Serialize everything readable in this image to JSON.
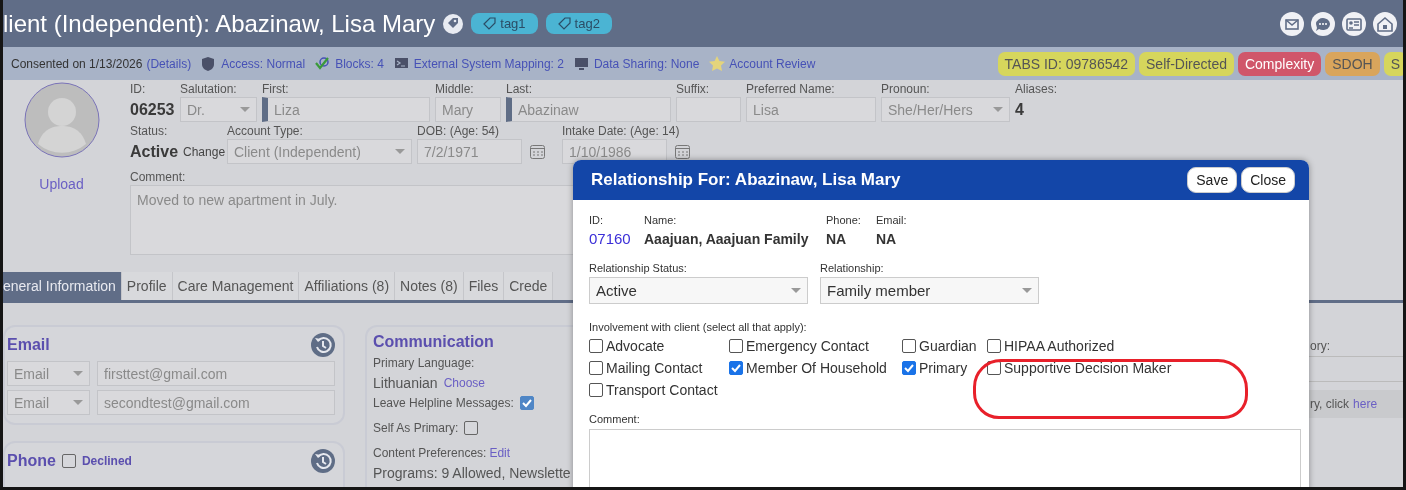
{
  "title_bar": {
    "title": "lient (Independent): Abazinaw, Lisa Mary",
    "tags": [
      "tag1",
      "tag2"
    ]
  },
  "info_bar": {
    "consent": {
      "text": "Consented on 1/13/2026",
      "link": "(Details)"
    },
    "items": [
      {
        "kind": "shield",
        "label": "Access: Normal"
      },
      {
        "kind": "check",
        "label": "Blocks: 4"
      },
      {
        "kind": "terminal",
        "label": "External System Mapping: 2"
      },
      {
        "kind": "monitor",
        "label": "Data Sharing: None"
      },
      {
        "kind": "star",
        "label": "Account Review"
      }
    ],
    "badges": [
      {
        "label": "TABS ID: 09786542",
        "color": "#d6d65c"
      },
      {
        "label": "Self-Directed",
        "color": "#d6d65c"
      },
      {
        "label": "Complexity",
        "color": "#d0566a"
      },
      {
        "label": "SDOH",
        "color": "#d9a55c"
      },
      {
        "label": "S",
        "color": "#d6d65c"
      }
    ]
  },
  "client": {
    "photo_link": "Upload",
    "id_label": "ID:",
    "id": "06253",
    "row_1": [
      {
        "label": "Salutation:",
        "value": "Dr.",
        "kind": "select"
      },
      {
        "label": "First:",
        "value": "Liza",
        "kind": "text",
        "required": true
      },
      {
        "label": "Middle:",
        "value": "Mary",
        "kind": "text",
        "required": false
      },
      {
        "label": "Last:",
        "value": "Abazinaw",
        "kind": "text",
        "required": true
      },
      {
        "label": "Suffix:",
        "kind": "text",
        "required": false
      },
      {
        "label": "Preferred Name:",
        "value": "Lisa",
        "kind": "text",
        "required": false
      },
      {
        "label": "Pronoun:",
        "value": "She/Her/Hers",
        "kind": "select"
      },
      {
        "label": "Aliases:",
        "value": "4",
        "kind": "count"
      }
    ],
    "status_label": "Status:",
    "status": "Active",
    "status_action": "Change",
    "row_2": [
      {
        "label": "Account Type:",
        "value": "Client (Independent)",
        "kind": "select"
      },
      {
        "label": "DOB: (Age: 54)",
        "value": "7/2/1971",
        "kind": "date"
      },
      {
        "label": "Intake Date: (Age: 14)",
        "value": "1/10/1986",
        "kind": "date"
      }
    ],
    "comment_label": "Comment:",
    "comment": "Moved to new apartment in July."
  },
  "tabs": [
    {
      "label": "eneral Information",
      "selected": true
    },
    {
      "label": "Profile",
      "selected": false
    },
    {
      "label": "Care Management",
      "selected": false
    },
    {
      "label": "Affiliations (8)",
      "selected": false
    },
    {
      "label": "Notes (8)",
      "selected": false
    },
    {
      "label": "Files",
      "selected": false
    },
    {
      "label": "Crede",
      "selected": false
    }
  ],
  "email_card": {
    "title": "Email",
    "rows": [
      {
        "type": "Email",
        "value": "firsttest@gmail.com"
      },
      {
        "type": "Email",
        "value": "secondtest@gmail.com"
      }
    ]
  },
  "phone_card": {
    "title": "Phone",
    "declined": {
      "label": "Declined",
      "checked": false
    }
  },
  "communication": {
    "title": "Communication",
    "language_label": "Primary Language:",
    "language": "Lithuanian",
    "language_action": "Choose",
    "helpline": {
      "label": "Leave Helpline Messages:",
      "checked": true
    },
    "self_primary": {
      "label": "Self As Primary:",
      "checked": false
    },
    "preferences_label": "Content Preferences:",
    "preferences_action": "Edit",
    "programs": "Programs: 9 Allowed, Newslette"
  },
  "background_panel": {
    "label": "ory:",
    "note": "ry, click",
    "link": "here"
  },
  "modal": {
    "title": "Relationship For: Abazinaw, Lisa Mary",
    "buttons": [
      "Save",
      "Close"
    ],
    "details": [
      {
        "label": "ID:",
        "value": "07160",
        "kind": "link"
      },
      {
        "label": "Name:",
        "value": "Aaajuan, Aaajuan Family",
        "kind": "bold"
      },
      {
        "label": "Phone:",
        "value": "NA",
        "kind": "bold"
      },
      {
        "label": "Email:",
        "value": "NA",
        "kind": "bold"
      }
    ],
    "selects": [
      {
        "label": "Relationship Status:",
        "value": "Active"
      },
      {
        "label": "Relationship:",
        "value": "Family member"
      }
    ],
    "involvement_label": "Involvement with client (select all that apply):",
    "involvement": [
      {
        "label": "Advocate",
        "checked": false
      },
      {
        "label": "Emergency Contact",
        "checked": false
      },
      {
        "label": "Guardian",
        "checked": false
      },
      {
        "label": "HIPAA Authorized",
        "checked": false
      },
      {
        "label": "Mailing Contact",
        "checked": false
      },
      {
        "label": "Member Of Household",
        "checked": true
      },
      {
        "label": "Primary",
        "checked": true
      },
      {
        "label": "Supportive Decision Maker",
        "checked": false
      },
      {
        "label": "Transport Contact",
        "checked": false
      }
    ],
    "comment_label": "Comment:",
    "highlight": true
  }
}
